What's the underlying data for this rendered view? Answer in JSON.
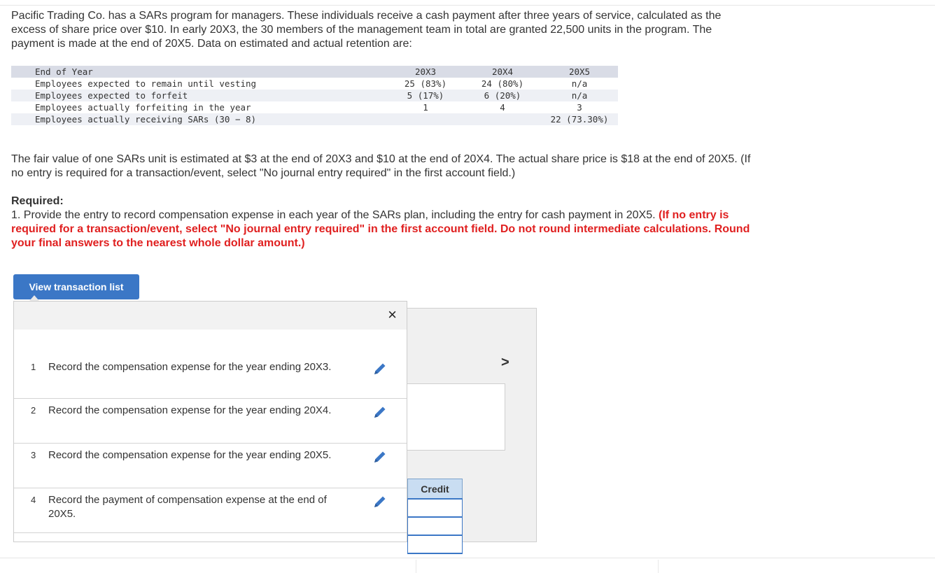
{
  "intro_text": "Pacific Trading Co. has a SARs program for managers. These individuals receive a cash payment after three years of service, calculated as the excess of share price over $10. In early 20X3, the 30 members of the management team in total are granted 22,500 units in the program. The payment is made at the end of 20X5. Data on estimated and actual retention are:",
  "retention_table": {
    "header": {
      "label": "End of Year",
      "c1": "20X3",
      "c2": "20X4",
      "c3": "20X5"
    },
    "rows": [
      {
        "label": "Employees expected to remain until vesting",
        "c1": "25 (83%)",
        "c2": "24 (80%)",
        "c3": "n/a"
      },
      {
        "label": "Employees expected to forfeit",
        "c1": "5 (17%)",
        "c2": "6 (20%)",
        "c3": "n/a"
      },
      {
        "label": "Employees actually forfeiting in the year",
        "c1": "1",
        "c2": "4",
        "c3": "3"
      },
      {
        "label": "Employees actually receiving SARs (30 − 8)",
        "c1": "",
        "c2": "",
        "c3": "22 (73.30%)"
      }
    ]
  },
  "fair_value_text": "The fair value of one SARs unit is estimated at $3 at the end of 20X3 and $10 at the end of 20X4. The actual share price is $18 at the end of 20X5. (If no entry is required for a transaction/event, select \"No journal entry required\" in the first account field.)",
  "required": {
    "title": "Required:",
    "body": "1. Provide the entry to record compensation expense in each year of the SARs plan, including the entry for cash payment in 20X5.",
    "instruction": "(If no entry is required for a transaction/event, select \"No journal entry required\" in the first account field. Do not round intermediate calculations. Round your final answers to the nearest whole dollar amount.)"
  },
  "view_button_label": "View transaction list",
  "close_label": "×",
  "next_label": ">",
  "credit_label": "Credit",
  "transactions": [
    {
      "num": "1",
      "text": "Record the compensation expense for the year ending 20X3."
    },
    {
      "num": "2",
      "text": "Record the compensation expense for the year ending 20X4."
    },
    {
      "num": "3",
      "text": "Record the compensation expense for the year ending 20X5."
    },
    {
      "num": "4",
      "text": "Record the payment of compensation expense at the end of 20X5."
    }
  ],
  "colors": {
    "accent": "#3b77c6",
    "warning": "#e02020"
  },
  "icons": {
    "edit": "pencil-icon",
    "close": "close-icon",
    "next": "chevron-right-icon"
  }
}
